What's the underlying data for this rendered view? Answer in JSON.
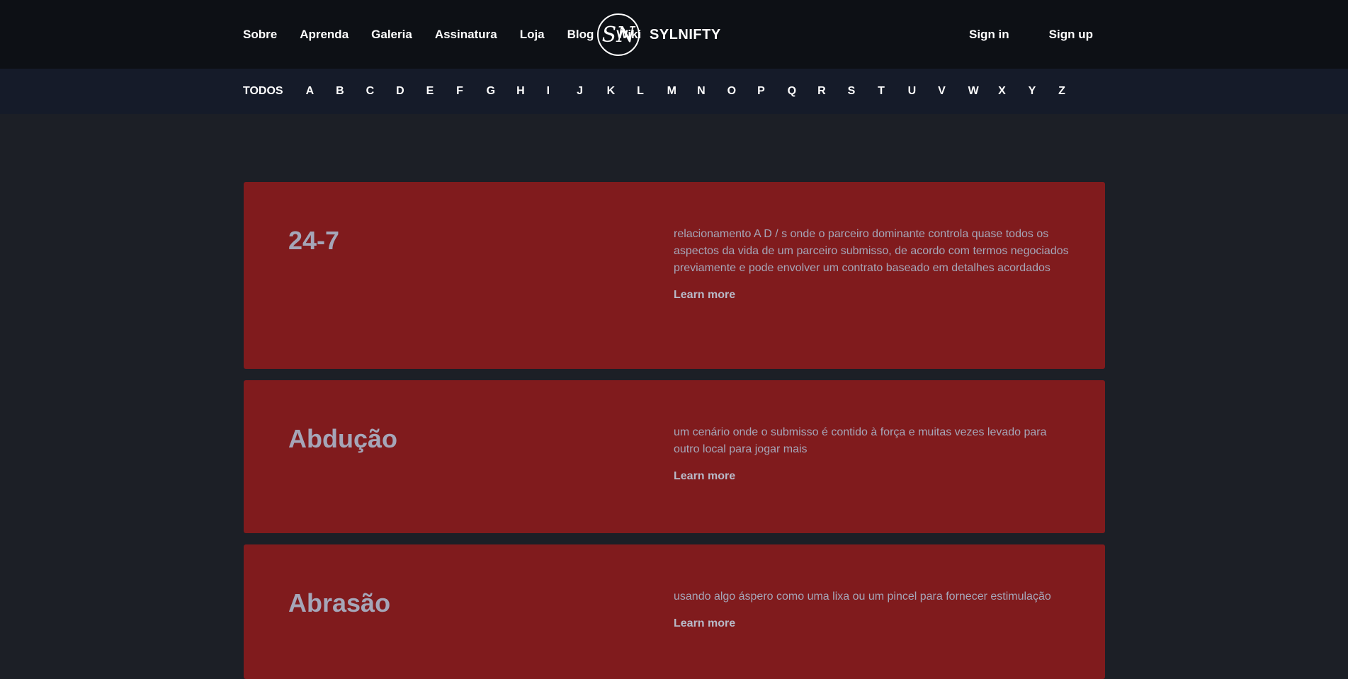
{
  "header": {
    "nav_left": [
      "Sobre",
      "Aprenda",
      "Galeria",
      "Assinatura",
      "Loja",
      "Blog",
      "Wiki"
    ],
    "logo": {
      "monogram": "SN",
      "name": "SYLNIFTY"
    },
    "sign_in": "Sign in",
    "sign_up": "Sign up"
  },
  "alphabet": {
    "all_label": "TODOS",
    "letters": [
      "A",
      "B",
      "C",
      "D",
      "E",
      "F",
      "G",
      "H",
      "I",
      "J",
      "K",
      "L",
      "M",
      "N",
      "O",
      "P",
      "Q",
      "R",
      "S",
      "T",
      "U",
      "V",
      "W",
      "X",
      "Y",
      "Z"
    ]
  },
  "entries": [
    {
      "title": "24-7",
      "description": " relacionamento A D / s onde o parceiro dominante controla quase todos os aspectos da vida de um parceiro submisso, de acordo com termos negociados previamente e pode envolver um contrato baseado em detalhes acordados",
      "link": "Learn more"
    },
    {
      "title": "Abdução",
      "description": " um cenário onde o submisso é contido à força e muitas vezes levado para outro local para jogar mais",
      "link": "Learn more"
    },
    {
      "title": "Abrasão",
      "description": " usando algo áspero como uma lixa ou um pincel para fornecer estimulação",
      "link": "Learn more"
    }
  ],
  "colors": {
    "page_bg": "#1c1f26",
    "header_bg": "#0d1015",
    "alphabar_bg": "#151b29",
    "card_bg": "#801b1d",
    "card_text": "#a5a6b8"
  }
}
